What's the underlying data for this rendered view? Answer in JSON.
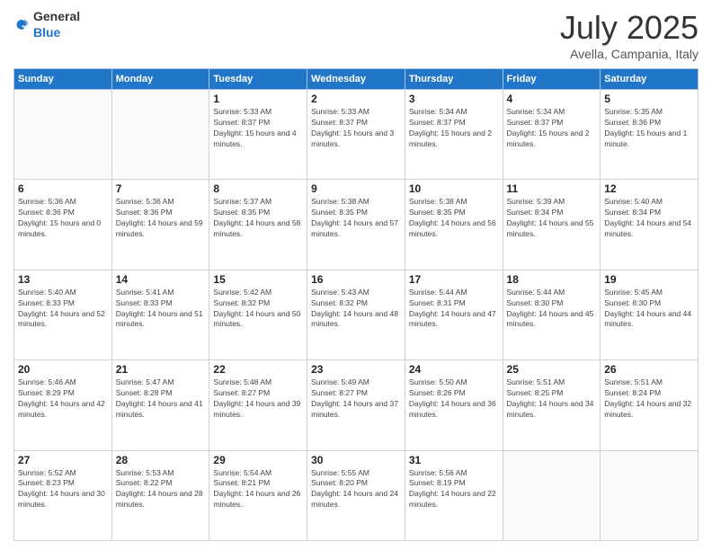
{
  "header": {
    "logo": {
      "text_general": "General",
      "text_blue": "Blue"
    },
    "month": "July 2025",
    "location": "Avella, Campania, Italy"
  },
  "weekdays": [
    "Sunday",
    "Monday",
    "Tuesday",
    "Wednesday",
    "Thursday",
    "Friday",
    "Saturday"
  ],
  "weeks": [
    [
      {
        "day": "",
        "empty": true
      },
      {
        "day": "",
        "empty": true
      },
      {
        "day": "1",
        "sunrise": "5:33 AM",
        "sunset": "8:37 PM",
        "daylight": "15 hours and 4 minutes."
      },
      {
        "day": "2",
        "sunrise": "5:33 AM",
        "sunset": "8:37 PM",
        "daylight": "15 hours and 3 minutes."
      },
      {
        "day": "3",
        "sunrise": "5:34 AM",
        "sunset": "8:37 PM",
        "daylight": "15 hours and 2 minutes."
      },
      {
        "day": "4",
        "sunrise": "5:34 AM",
        "sunset": "8:37 PM",
        "daylight": "15 hours and 2 minutes."
      },
      {
        "day": "5",
        "sunrise": "5:35 AM",
        "sunset": "8:36 PM",
        "daylight": "15 hours and 1 minute."
      }
    ],
    [
      {
        "day": "6",
        "sunrise": "5:36 AM",
        "sunset": "8:36 PM",
        "daylight": "15 hours and 0 minutes."
      },
      {
        "day": "7",
        "sunrise": "5:36 AM",
        "sunset": "8:36 PM",
        "daylight": "14 hours and 59 minutes."
      },
      {
        "day": "8",
        "sunrise": "5:37 AM",
        "sunset": "8:35 PM",
        "daylight": "14 hours and 58 minutes."
      },
      {
        "day": "9",
        "sunrise": "5:38 AM",
        "sunset": "8:35 PM",
        "daylight": "14 hours and 57 minutes."
      },
      {
        "day": "10",
        "sunrise": "5:38 AM",
        "sunset": "8:35 PM",
        "daylight": "14 hours and 56 minutes."
      },
      {
        "day": "11",
        "sunrise": "5:39 AM",
        "sunset": "8:34 PM",
        "daylight": "14 hours and 55 minutes."
      },
      {
        "day": "12",
        "sunrise": "5:40 AM",
        "sunset": "8:34 PM",
        "daylight": "14 hours and 54 minutes."
      }
    ],
    [
      {
        "day": "13",
        "sunrise": "5:40 AM",
        "sunset": "8:33 PM",
        "daylight": "14 hours and 52 minutes."
      },
      {
        "day": "14",
        "sunrise": "5:41 AM",
        "sunset": "8:33 PM",
        "daylight": "14 hours and 51 minutes."
      },
      {
        "day": "15",
        "sunrise": "5:42 AM",
        "sunset": "8:32 PM",
        "daylight": "14 hours and 50 minutes."
      },
      {
        "day": "16",
        "sunrise": "5:43 AM",
        "sunset": "8:32 PM",
        "daylight": "14 hours and 48 minutes."
      },
      {
        "day": "17",
        "sunrise": "5:44 AM",
        "sunset": "8:31 PM",
        "daylight": "14 hours and 47 minutes."
      },
      {
        "day": "18",
        "sunrise": "5:44 AM",
        "sunset": "8:30 PM",
        "daylight": "14 hours and 45 minutes."
      },
      {
        "day": "19",
        "sunrise": "5:45 AM",
        "sunset": "8:30 PM",
        "daylight": "14 hours and 44 minutes."
      }
    ],
    [
      {
        "day": "20",
        "sunrise": "5:46 AM",
        "sunset": "8:29 PM",
        "daylight": "14 hours and 42 minutes."
      },
      {
        "day": "21",
        "sunrise": "5:47 AM",
        "sunset": "8:28 PM",
        "daylight": "14 hours and 41 minutes."
      },
      {
        "day": "22",
        "sunrise": "5:48 AM",
        "sunset": "8:27 PM",
        "daylight": "14 hours and 39 minutes."
      },
      {
        "day": "23",
        "sunrise": "5:49 AM",
        "sunset": "8:27 PM",
        "daylight": "14 hours and 37 minutes."
      },
      {
        "day": "24",
        "sunrise": "5:50 AM",
        "sunset": "8:26 PM",
        "daylight": "14 hours and 36 minutes."
      },
      {
        "day": "25",
        "sunrise": "5:51 AM",
        "sunset": "8:25 PM",
        "daylight": "14 hours and 34 minutes."
      },
      {
        "day": "26",
        "sunrise": "5:51 AM",
        "sunset": "8:24 PM",
        "daylight": "14 hours and 32 minutes."
      }
    ],
    [
      {
        "day": "27",
        "sunrise": "5:52 AM",
        "sunset": "8:23 PM",
        "daylight": "14 hours and 30 minutes."
      },
      {
        "day": "28",
        "sunrise": "5:53 AM",
        "sunset": "8:22 PM",
        "daylight": "14 hours and 28 minutes."
      },
      {
        "day": "29",
        "sunrise": "5:54 AM",
        "sunset": "8:21 PM",
        "daylight": "14 hours and 26 minutes."
      },
      {
        "day": "30",
        "sunrise": "5:55 AM",
        "sunset": "8:20 PM",
        "daylight": "14 hours and 24 minutes."
      },
      {
        "day": "31",
        "sunrise": "5:56 AM",
        "sunset": "8:19 PM",
        "daylight": "14 hours and 22 minutes."
      },
      {
        "day": "",
        "empty": true
      },
      {
        "day": "",
        "empty": true
      }
    ]
  ],
  "labels": {
    "sunrise": "Sunrise:",
    "sunset": "Sunset:",
    "daylight": "Daylight:"
  }
}
